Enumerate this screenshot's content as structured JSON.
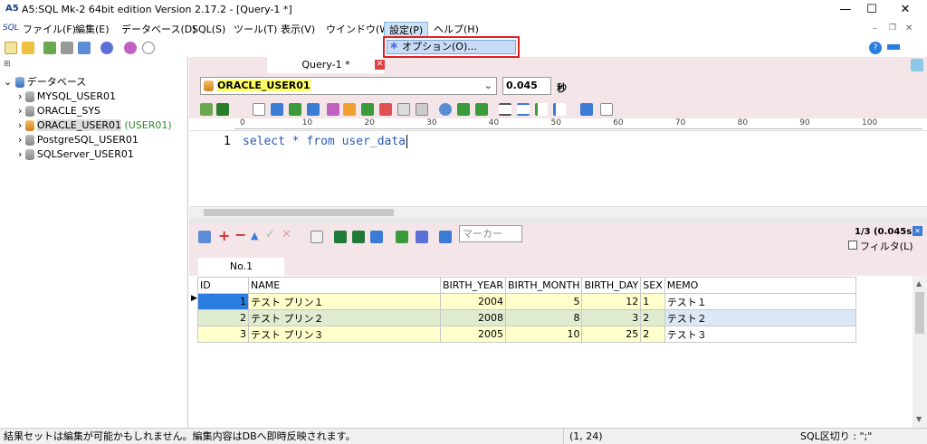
{
  "title": "A5:SQL Mk-2 64bit edition Version 2.17.2 - [Query-1 *]",
  "window": {
    "minimize": "—",
    "maximize": "☐",
    "close": "✕"
  },
  "menu": [
    {
      "label": "ファイル(F)"
    },
    {
      "label": "編集(E)"
    },
    {
      "label": "データベース(D)"
    },
    {
      "label": "SQL(S)"
    },
    {
      "label": "ツール(T)"
    },
    {
      "label": "表示(V)"
    },
    {
      "label": "ウインドウ(W)"
    },
    {
      "label": "設定(P)"
    },
    {
      "label": "ヘルプ(H)"
    }
  ],
  "menu_logo": "SQL",
  "dropdown": {
    "item": "オプション(O)..."
  },
  "tree": {
    "root": "データベース",
    "items": [
      {
        "label": "MYSQL_USER01"
      },
      {
        "label": "ORACLE_SYS"
      },
      {
        "label": "ORACLE_USER01",
        "extra": "(USER01)"
      },
      {
        "label": "PostgreSQL_USER01"
      },
      {
        "label": "SQLServer_USER01"
      }
    ]
  },
  "doc_tab": "Query-1 *",
  "connection": "ORACLE_USER01",
  "time": "0.045",
  "time_unit": "秒",
  "ruler": [
    "0",
    "10",
    "20",
    "30",
    "40",
    "50",
    "60",
    "70",
    "80",
    "90",
    "100"
  ],
  "editor": {
    "line": "1",
    "sql": "select * from user_data"
  },
  "result": {
    "marker_placeholder": "マーカー",
    "count": "1/3 (0.045s)",
    "filter": "フィルタ(L)",
    "tab": "No.1"
  },
  "grid": {
    "headers": [
      "ID",
      "NAME",
      "BIRTH_YEAR",
      "BIRTH_MONTH",
      "BIRTH_DAY",
      "SEX",
      "MEMO"
    ],
    "rows": [
      [
        "1",
        "テスト プリン１",
        "2004",
        "5",
        "12",
        "1",
        "テスト１"
      ],
      [
        "2",
        "テスト プリン２",
        "2008",
        "8",
        "3",
        "2",
        "テスト２"
      ],
      [
        "3",
        "テスト プリン３",
        "2005",
        "10",
        "25",
        "2",
        "テスト３"
      ]
    ]
  },
  "status": {
    "message": "結果セットは編集が可能かもしれません。編集内容はDBへ即時反映されます。",
    "position": "(1, 24)",
    "delimiter": "SQL区切り : \";\""
  },
  "colors": {
    "panel_bg": "#f4e6e8",
    "row_yellow": "#ffffcc",
    "row_green": "#e0ecd0",
    "highlight": "#e02020"
  }
}
